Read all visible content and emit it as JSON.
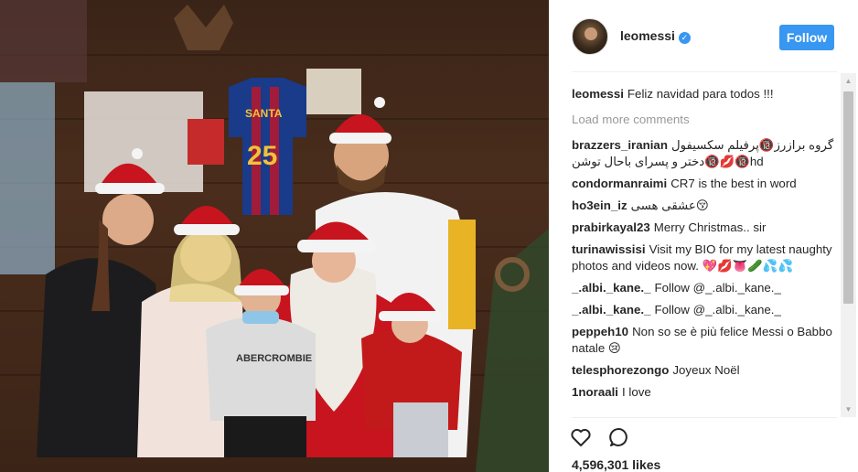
{
  "photo": {
    "alt": ""
  },
  "photo_text": {
    "jersey_name": "SANTA",
    "jersey_number": "25",
    "shirt_brand": "ABERCROMBIE"
  },
  "post": {
    "author": "leomessi",
    "follow_label": "Follow",
    "caption_user": "leomessi",
    "caption_text": "Feliz navidad para todos !!!",
    "load_more": "Load more comments",
    "comments": [
      {
        "user": "brazzers_iranian",
        "text": "گروه برازرز🔞پرفیلم سکسیفول💋🔞دختر و پسرای باحال توشن🔞hd"
      },
      {
        "user": "condormanraimi",
        "text": "CR7 is the best in word"
      },
      {
        "user": "ho3ein_iz",
        "text": "عشقی هسی😚"
      },
      {
        "user": "prabirkayal23",
        "text": "Merry Christmas.. sir"
      },
      {
        "user": "turinawissisi",
        "text": "Visit my BIO for my latest naughty photos and videos now. 💖💋👅🥒💦💦"
      },
      {
        "user": "_.albi._kane._",
        "text": "Follow @_.albi._kane._"
      },
      {
        "user": "_.albi._kane._",
        "text": "Follow @_.albi._kane._"
      },
      {
        "user": "peppeh10",
        "text": "Non so se è più felice Messi o Babbo natale 😢"
      },
      {
        "user": "telesphorezongo",
        "text": "Joyeux Noël"
      },
      {
        "user": "1noraali",
        "text": "I love"
      }
    ],
    "likes": "4,596,301 likes"
  },
  "icons": {
    "like": "heart-icon",
    "comment": "comment-icon",
    "verified": "verified-badge-icon"
  },
  "colors": {
    "accent": "#3897f0",
    "text": "#262626",
    "muted": "#999999"
  }
}
